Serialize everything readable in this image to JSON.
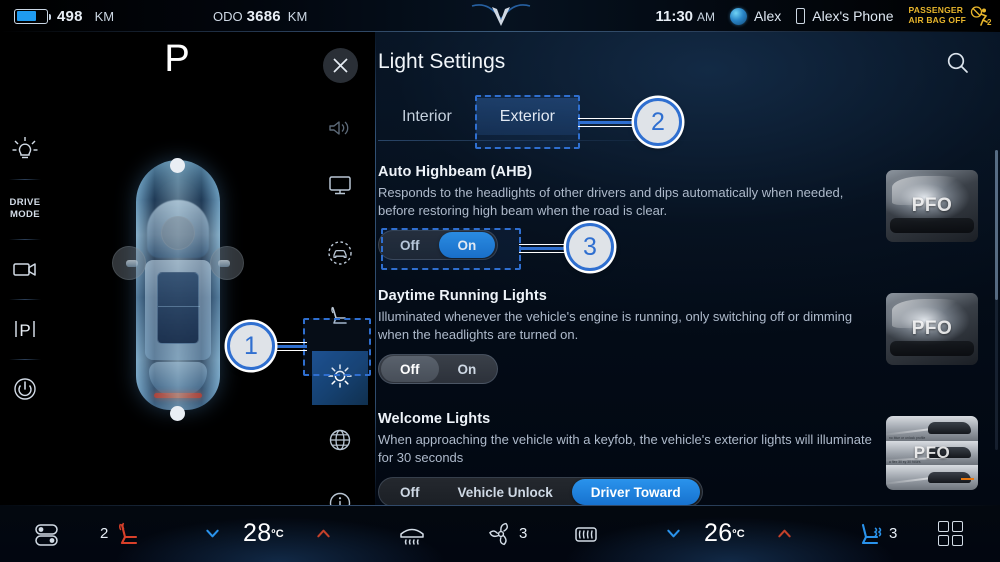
{
  "statusbar": {
    "range_value": "498",
    "range_unit": "KM",
    "odo_label": "ODO",
    "odo_value": "3686",
    "odo_unit": "KM",
    "time": "11:30",
    "time_period": "AM",
    "profile_name": "Alex",
    "phone_name": "Alex's Phone",
    "airbag_line1": "PASSENGER",
    "airbag_line2": "AIR BAG OFF",
    "airbag_count": "2",
    "brand_logo": "v-logo"
  },
  "left_rail": {
    "items": [
      {
        "name": "lights",
        "icon": "headlight-icon",
        "label": ""
      },
      {
        "name": "drive-mode",
        "icon": "drive-mode-icon",
        "label": "DRIVE\nMODE",
        "label_line1": "DRIVE",
        "label_line2": "MODE"
      },
      {
        "name": "camera",
        "icon": "camera-icon",
        "label": ""
      },
      {
        "name": "parking",
        "icon": "parking-p-icon",
        "label": "P"
      },
      {
        "name": "power",
        "icon": "power-icon",
        "label": ""
      }
    ]
  },
  "car_view": {
    "gear": "P",
    "vehicle_alt": "top-down-car-render"
  },
  "panel": {
    "close_icon": "close-icon",
    "title": "Light Settings",
    "search_icon": "search-icon",
    "rail_items": [
      {
        "name": "sound",
        "icon": "speaker-icon",
        "selected": false
      },
      {
        "name": "display",
        "icon": "monitor-icon",
        "selected": false
      },
      {
        "name": "driving-assist",
        "icon": "car-sensor-icon",
        "selected": false
      },
      {
        "name": "seat",
        "icon": "seat-icon",
        "selected": false
      },
      {
        "name": "light",
        "icon": "sun-icon",
        "selected": true
      },
      {
        "name": "connectivity",
        "icon": "globe-icon",
        "selected": false
      },
      {
        "name": "info",
        "icon": "info-icon",
        "selected": false
      }
    ],
    "tabs": [
      {
        "label": "Interior",
        "active": false
      },
      {
        "label": "Exterior",
        "active": true
      }
    ],
    "settings": [
      {
        "title": "Auto Highbeam (AHB)",
        "description": "Responds to the headlights of other drivers and dips automatically when needed, before restoring high beam when the road is clear.",
        "options": [
          "Off",
          "On"
        ],
        "selected": "On",
        "thumb_watermark": "PFO"
      },
      {
        "title": "Daytime Running Lights",
        "description": "Illuminated whenever the vehicle's engine is running, only switching off or dimming when the headlights are turned on.",
        "options": [
          "Off",
          "On"
        ],
        "selected": "Off",
        "thumb_watermark": "PFO"
      },
      {
        "title": "Welcome Lights",
        "description": "When approaching the vehicle with a keyfob, the vehicle's exterior lights will illuminate for 30 seconds",
        "options": [
          "Off",
          "Vehicle Unlock",
          "Driver Toward"
        ],
        "selected": "Driver Toward",
        "thumb_watermark": "PFO"
      }
    ]
  },
  "annotations": [
    {
      "number": "1",
      "target": "light-sidebar-icon"
    },
    {
      "number": "2",
      "target": "exterior-tab"
    },
    {
      "number": "3",
      "target": "auto-highbeam-toggle"
    }
  ],
  "climate": {
    "toggle_icon": "settings-toggle-icon",
    "driver_seat_heat_level": "2",
    "driver_seat_icon": "heated-seat-icon",
    "driver_temp": "28",
    "driver_temp_unit": "ºC",
    "front_defrost_icon": "front-defrost-icon",
    "fan_icon": "fan-icon",
    "fan_level": "3",
    "rear_defrost_icon": "rear-defrost-icon",
    "passenger_temp": "26",
    "passenger_temp_unit": "ºC",
    "passenger_seat_icon": "ventilated-seat-icon",
    "passenger_seat_level": "3",
    "apps_icon": "apps-grid-icon",
    "chevron_down_icon": "chevron-down-icon",
    "chevron_up_icon": "chevron-up-icon"
  },
  "colors": {
    "accent_blue": "#2a93ec",
    "annotation_blue": "#2f6fd0",
    "warning_amber": "#e8b62c",
    "panel_bg": "#061322"
  }
}
